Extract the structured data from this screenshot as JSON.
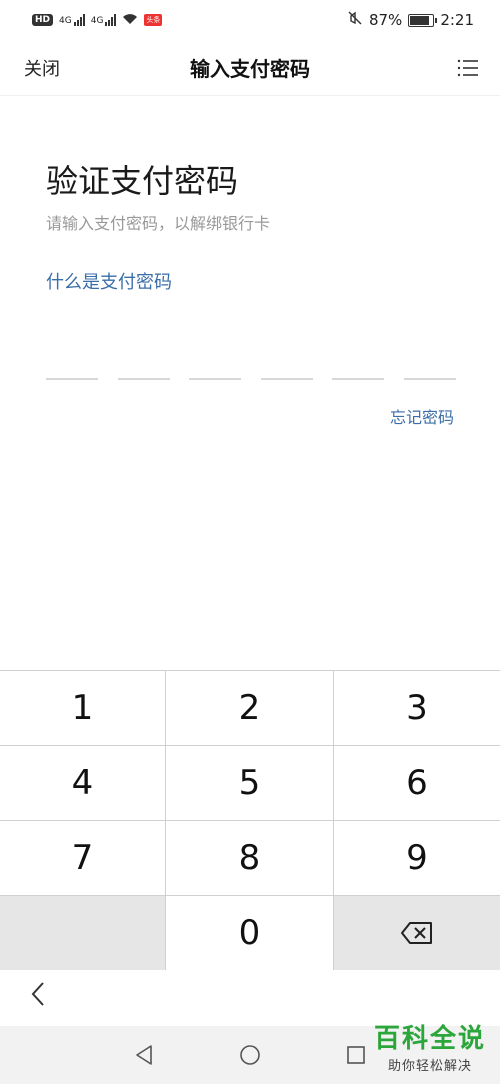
{
  "status_bar": {
    "hd_badge": "HD",
    "network_1": "4G",
    "network_2": "4G",
    "app_badge": "头条",
    "battery_percent": "87%",
    "battery_level": 0.87,
    "time": "2:21",
    "icons": [
      "hd-icon",
      "signal-icon",
      "signal-icon",
      "wifi-icon",
      "notification-icon",
      "mute-icon",
      "battery-icon"
    ]
  },
  "header": {
    "close_label": "关闭",
    "title": "输入支付密码",
    "menu_icon": "list-menu-icon"
  },
  "main": {
    "verify_title": "验证支付密码",
    "subtitle": "请输入支付密码，以解绑银行卡",
    "what_is_link": "什么是支付密码",
    "pin_length": 6,
    "forgot_link": "忘记密码"
  },
  "keypad": {
    "keys": [
      "1",
      "2",
      "3",
      "4",
      "5",
      "6",
      "7",
      "8",
      "9",
      "",
      "0",
      "⌫"
    ],
    "backspace_icon": "backspace-icon"
  },
  "bottom": {
    "back_icon": "chevron-left-icon"
  },
  "nav_bar": {
    "icons": [
      "back-triangle-icon",
      "home-circle-icon",
      "recents-square-icon"
    ]
  },
  "watermark": {
    "title": "百科全说",
    "subtitle": "助你轻松解决"
  },
  "colors": {
    "link": "#3a6ea8",
    "watermark_green": "#2aa63a",
    "subtitle_gray": "#999999"
  }
}
